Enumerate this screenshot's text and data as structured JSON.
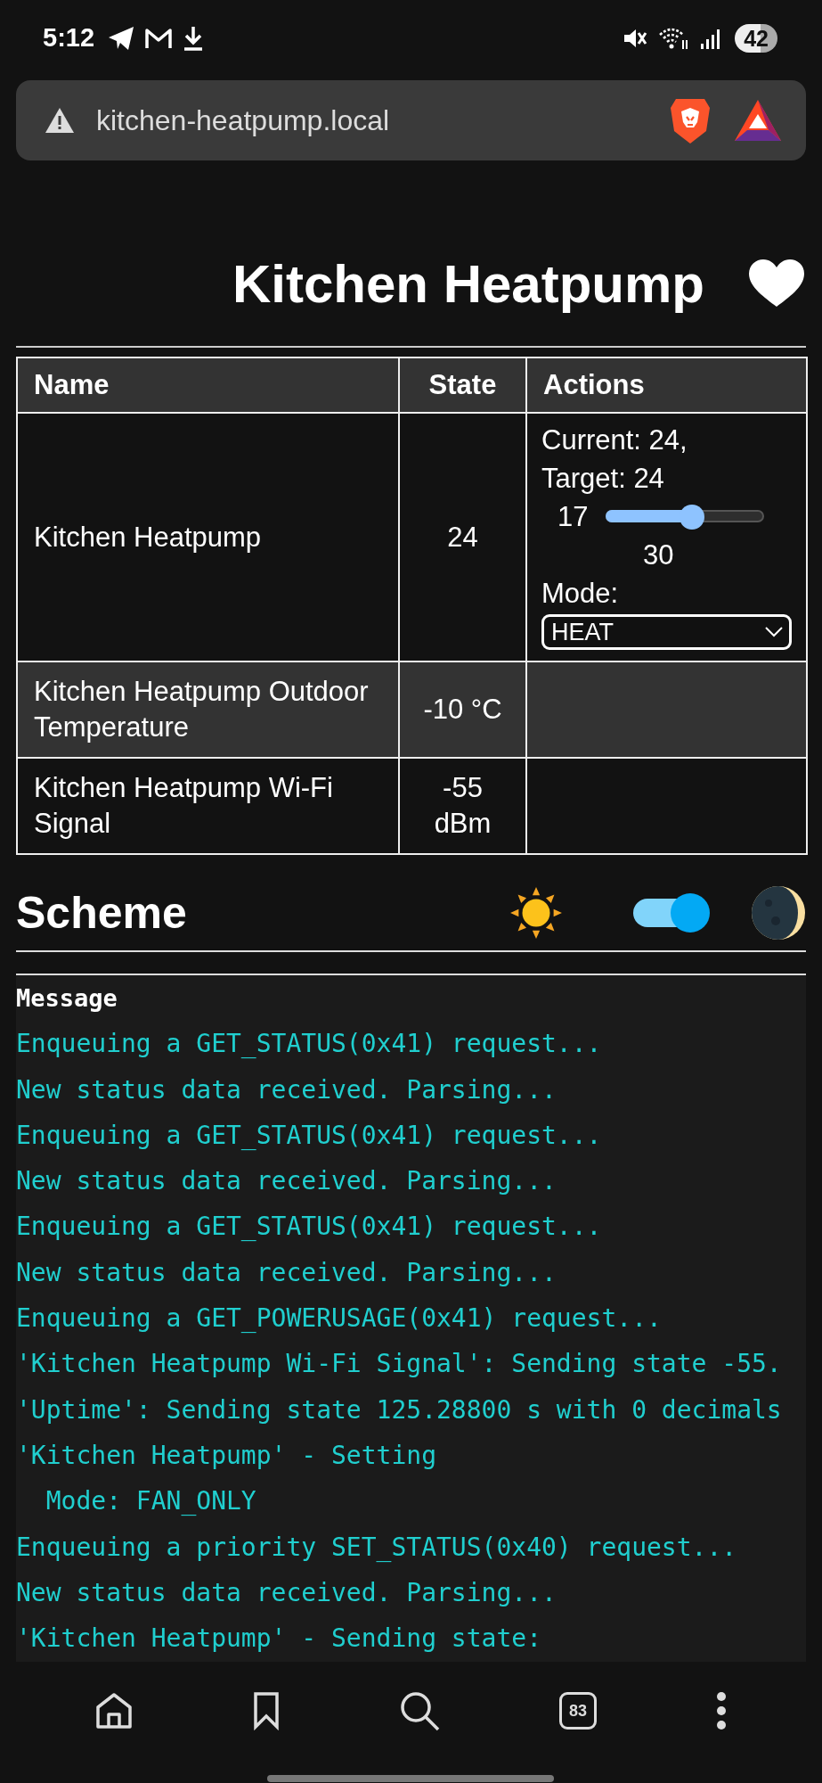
{
  "status_bar": {
    "time": "5:12",
    "battery": "42"
  },
  "address_bar": {
    "url": "kitchen-heatpump.local"
  },
  "page": {
    "title": "Kitchen Heatpump"
  },
  "table": {
    "columns": [
      "Name",
      "State",
      "Actions"
    ],
    "rows": [
      {
        "kind": "climate",
        "name": "Kitchen Heatpump",
        "state": "24",
        "actions": {
          "current": "Current: 24,",
          "target": "Target: 24",
          "min": "17",
          "max": "30",
          "level": 0.54,
          "mode_label": "Mode:",
          "mode": "HEAT"
        }
      },
      {
        "kind": "sensor",
        "name": "Kitchen Heatpump Outdoor Temperature",
        "state": "-10 °C"
      },
      {
        "kind": "sensor",
        "name": "Kitchen Heatpump Wi-Fi Signal",
        "state": "-55 dBm"
      }
    ]
  },
  "scheme": {
    "title": "Scheme",
    "dark": true
  },
  "log": {
    "header": "Message",
    "lines": [
      "Enqueuing a GET_STATUS(0x41) request...",
      "New status data received. Parsing...",
      "Enqueuing a GET_STATUS(0x41) request...",
      "New status data received. Parsing...",
      "Enqueuing a GET_STATUS(0x41) request...",
      "New status data received. Parsing...",
      "Enqueuing a GET_POWERUSAGE(0x41) request...",
      "'Kitchen Heatpump Wi-Fi Signal': Sending state -55.",
      "'Uptime': Sending state 125.28800 s with 0 decimals",
      "'Kitchen Heatpump' - Setting",
      "  Mode: FAN_ONLY",
      "Enqueuing a priority SET_STATUS(0x40) request...",
      "New status data received. Parsing...",
      "'Kitchen Heatpump' - Sending state:"
    ]
  },
  "bottom_nav": {
    "tab_count": "83"
  }
}
